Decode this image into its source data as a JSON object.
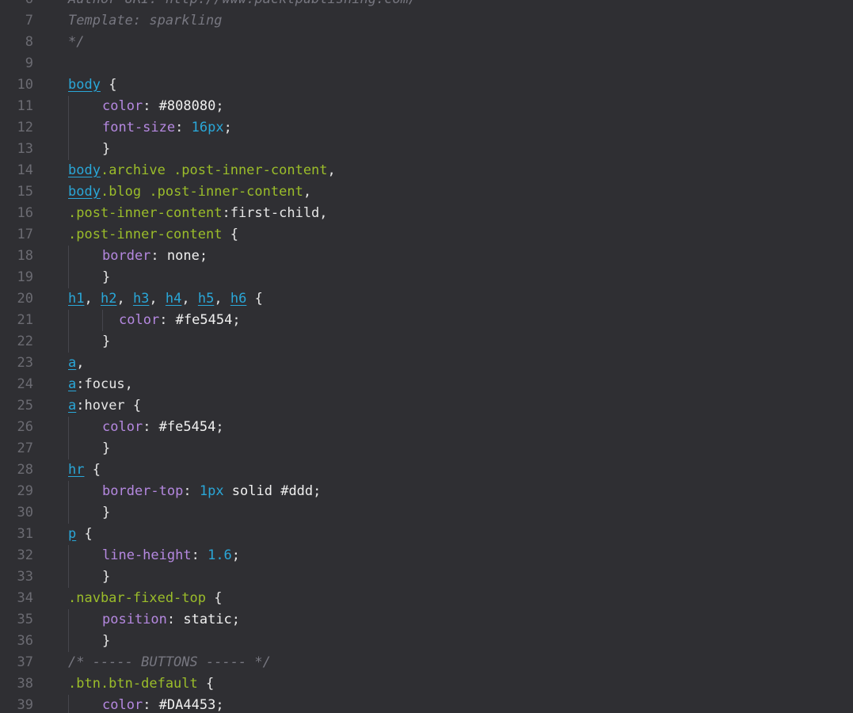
{
  "editor": {
    "language": "css",
    "colors": {
      "background": "#2f2f33",
      "gutter_text": "#6b6b72",
      "selector": "#2aa7d8",
      "class": "#9bbd2a",
      "property": "#b588e0",
      "number": "#2aa7d8",
      "value": "#f0f0f0",
      "comment": "#777780"
    },
    "lines": [
      {
        "no": "6",
        "indent": 0,
        "tokens": [
          {
            "t": "Author URI: http://www.packtpublishing.com/",
            "c": "cmt"
          }
        ]
      },
      {
        "no": "7",
        "indent": 0,
        "tokens": [
          {
            "t": "Template: sparkling",
            "c": "cmt"
          }
        ]
      },
      {
        "no": "8",
        "indent": 0,
        "tokens": [
          {
            "t": "*/",
            "c": "cmt"
          }
        ]
      },
      {
        "no": "9",
        "indent": 0,
        "tokens": []
      },
      {
        "no": "10",
        "indent": 0,
        "tokens": [
          {
            "t": "body",
            "c": "sel"
          },
          {
            "t": " {",
            "c": "punc"
          }
        ]
      },
      {
        "no": "11",
        "indent": 1,
        "tokens": [
          {
            "t": "color",
            "c": "prop"
          },
          {
            "t": ": ",
            "c": "punc"
          },
          {
            "t": "#808080",
            "c": "val"
          },
          {
            "t": ";",
            "c": "punc"
          }
        ]
      },
      {
        "no": "12",
        "indent": 1,
        "tokens": [
          {
            "t": "font-size",
            "c": "prop"
          },
          {
            "t": ": ",
            "c": "punc"
          },
          {
            "t": "16px",
            "c": "num"
          },
          {
            "t": ";",
            "c": "punc"
          }
        ]
      },
      {
        "no": "13",
        "indent": 1,
        "tokens": [
          {
            "t": "}",
            "c": "punc"
          }
        ]
      },
      {
        "no": "14",
        "indent": 0,
        "tokens": [
          {
            "t": "body",
            "c": "sel"
          },
          {
            "t": ".archive .post-inner-content",
            "c": "cls"
          },
          {
            "t": ",",
            "c": "punc"
          }
        ]
      },
      {
        "no": "15",
        "indent": 0,
        "tokens": [
          {
            "t": "body",
            "c": "sel"
          },
          {
            "t": ".blog .post-inner-content",
            "c": "cls"
          },
          {
            "t": ",",
            "c": "punc"
          }
        ]
      },
      {
        "no": "16",
        "indent": 0,
        "tokens": [
          {
            "t": ".post-inner-content",
            "c": "cls"
          },
          {
            "t": ":first-child,",
            "c": "punc"
          }
        ]
      },
      {
        "no": "17",
        "indent": 0,
        "tokens": [
          {
            "t": ".post-inner-content",
            "c": "cls"
          },
          {
            "t": " {",
            "c": "punc"
          }
        ]
      },
      {
        "no": "18",
        "indent": 1,
        "tokens": [
          {
            "t": "border",
            "c": "prop"
          },
          {
            "t": ": ",
            "c": "punc"
          },
          {
            "t": "none",
            "c": "val"
          },
          {
            "t": ";",
            "c": "punc"
          }
        ]
      },
      {
        "no": "19",
        "indent": 1,
        "tokens": [
          {
            "t": "}",
            "c": "punc"
          }
        ]
      },
      {
        "no": "20",
        "indent": 0,
        "tokens": [
          {
            "t": "h1",
            "c": "sel"
          },
          {
            "t": ", ",
            "c": "punc"
          },
          {
            "t": "h2",
            "c": "sel"
          },
          {
            "t": ", ",
            "c": "punc"
          },
          {
            "t": "h3",
            "c": "sel"
          },
          {
            "t": ", ",
            "c": "punc"
          },
          {
            "t": "h4",
            "c": "sel"
          },
          {
            "t": ", ",
            "c": "punc"
          },
          {
            "t": "h5",
            "c": "sel"
          },
          {
            "t": ", ",
            "c": "punc"
          },
          {
            "t": "h6",
            "c": "sel"
          },
          {
            "t": " {",
            "c": "punc"
          }
        ]
      },
      {
        "no": "21",
        "indent": 2,
        "tokens": [
          {
            "t": "color",
            "c": "prop"
          },
          {
            "t": ": ",
            "c": "punc"
          },
          {
            "t": "#fe5454",
            "c": "val"
          },
          {
            "t": ";",
            "c": "punc"
          }
        ]
      },
      {
        "no": "22",
        "indent": 1,
        "tokens": [
          {
            "t": "}",
            "c": "punc"
          }
        ]
      },
      {
        "no": "23",
        "indent": 0,
        "tokens": [
          {
            "t": "a",
            "c": "sel"
          },
          {
            "t": ",",
            "c": "punc"
          }
        ]
      },
      {
        "no": "24",
        "indent": 0,
        "tokens": [
          {
            "t": "a",
            "c": "sel"
          },
          {
            "t": ":focus,",
            "c": "punc"
          }
        ]
      },
      {
        "no": "25",
        "indent": 0,
        "tokens": [
          {
            "t": "a",
            "c": "sel"
          },
          {
            "t": ":hover {",
            "c": "punc"
          }
        ]
      },
      {
        "no": "26",
        "indent": 1,
        "tokens": [
          {
            "t": "color",
            "c": "prop"
          },
          {
            "t": ": ",
            "c": "punc"
          },
          {
            "t": "#fe5454",
            "c": "val"
          },
          {
            "t": ";",
            "c": "punc"
          }
        ]
      },
      {
        "no": "27",
        "indent": 1,
        "tokens": [
          {
            "t": "}",
            "c": "punc"
          }
        ]
      },
      {
        "no": "28",
        "indent": 0,
        "tokens": [
          {
            "t": "hr",
            "c": "sel"
          },
          {
            "t": " {",
            "c": "punc"
          }
        ]
      },
      {
        "no": "29",
        "indent": 1,
        "tokens": [
          {
            "t": "border-top",
            "c": "prop"
          },
          {
            "t": ": ",
            "c": "punc"
          },
          {
            "t": "1px",
            "c": "num"
          },
          {
            "t": " solid #ddd",
            "c": "val"
          },
          {
            "t": ";",
            "c": "punc"
          }
        ]
      },
      {
        "no": "30",
        "indent": 1,
        "tokens": [
          {
            "t": "}",
            "c": "punc"
          }
        ]
      },
      {
        "no": "31",
        "indent": 0,
        "tokens": [
          {
            "t": "p",
            "c": "sel"
          },
          {
            "t": " {",
            "c": "punc"
          }
        ]
      },
      {
        "no": "32",
        "indent": 1,
        "tokens": [
          {
            "t": "line-height",
            "c": "prop"
          },
          {
            "t": ": ",
            "c": "punc"
          },
          {
            "t": "1.6",
            "c": "num"
          },
          {
            "t": ";",
            "c": "punc"
          }
        ]
      },
      {
        "no": "33",
        "indent": 1,
        "tokens": [
          {
            "t": "}",
            "c": "punc"
          }
        ]
      },
      {
        "no": "34",
        "indent": 0,
        "tokens": [
          {
            "t": ".navbar-fixed-top",
            "c": "cls"
          },
          {
            "t": " {",
            "c": "punc"
          }
        ]
      },
      {
        "no": "35",
        "indent": 1,
        "tokens": [
          {
            "t": "position",
            "c": "prop"
          },
          {
            "t": ": ",
            "c": "punc"
          },
          {
            "t": "static",
            "c": "val"
          },
          {
            "t": ";",
            "c": "punc"
          }
        ]
      },
      {
        "no": "36",
        "indent": 1,
        "tokens": [
          {
            "t": "}",
            "c": "punc"
          }
        ]
      },
      {
        "no": "37",
        "indent": 0,
        "tokens": [
          {
            "t": "/* ----- BUTTONS ----- */",
            "c": "cmt"
          }
        ]
      },
      {
        "no": "38",
        "indent": 0,
        "tokens": [
          {
            "t": ".btn.btn-default",
            "c": "cls"
          },
          {
            "t": " {",
            "c": "punc"
          }
        ]
      },
      {
        "no": "39",
        "indent": 1,
        "tokens": [
          {
            "t": "color",
            "c": "prop"
          },
          {
            "t": ": ",
            "c": "punc"
          },
          {
            "t": "#DA4453",
            "c": "val"
          },
          {
            "t": ";",
            "c": "punc"
          }
        ]
      }
    ]
  }
}
